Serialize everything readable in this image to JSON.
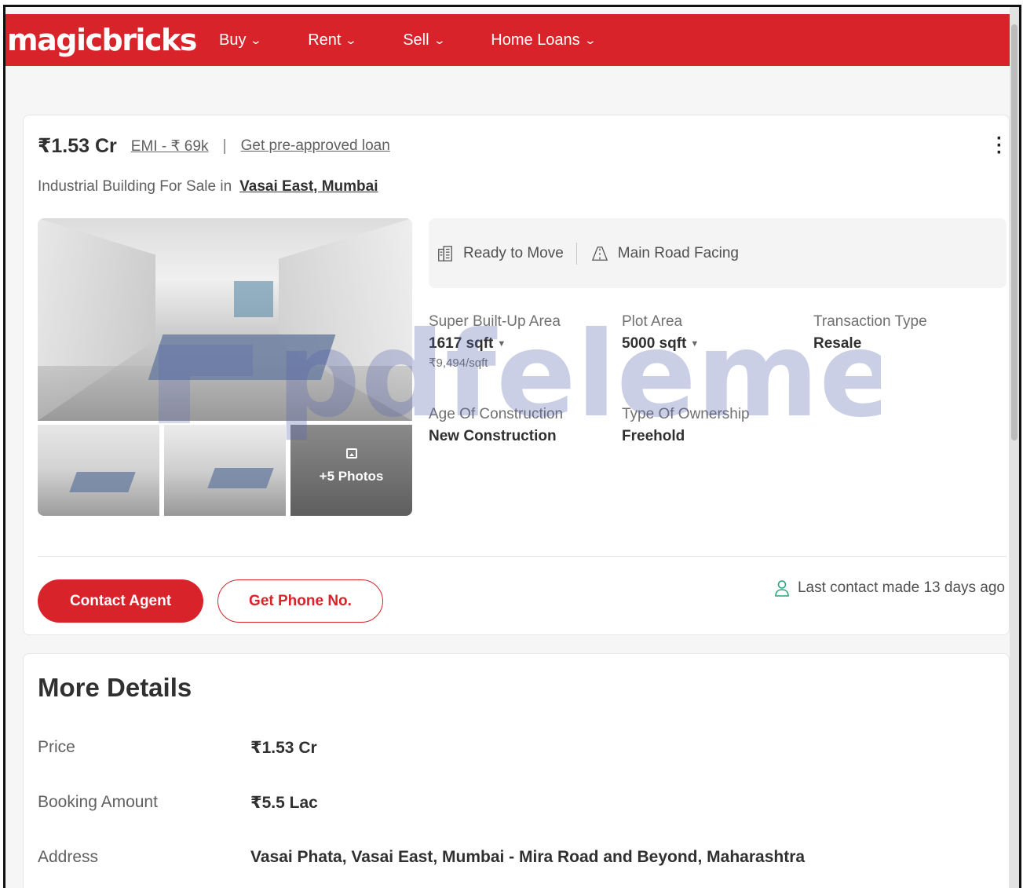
{
  "header": {
    "logo": "magicbricks",
    "nav": [
      {
        "label": "Buy"
      },
      {
        "label": "Rent"
      },
      {
        "label": "Sell"
      },
      {
        "label": "Home Loans"
      }
    ]
  },
  "listing": {
    "price": "₹1.53 Cr",
    "emi": "EMI - ₹ 69k",
    "separator": "|",
    "loan_link": "Get pre-approved loan",
    "title_prefix": "Industrial Building For Sale in",
    "location": "Vasai East, Mumbai",
    "more_photos": "+5 Photos",
    "highlights": [
      {
        "label": "Ready to Move",
        "icon": "building-icon"
      },
      {
        "label": "Main Road Facing",
        "icon": "road-icon"
      }
    ],
    "summary": {
      "super_area_label": "Super Built-Up Area",
      "super_area_value": "1617 sqft",
      "super_area_rate": "₹9,494/sqft",
      "plot_area_label": "Plot Area",
      "plot_area_value": "5000 sqft",
      "transaction_label": "Transaction Type",
      "transaction_value": "Resale",
      "age_label": "Age Of Construction",
      "age_value": "New Construction",
      "ownership_label": "Type Of Ownership",
      "ownership_value": "Freehold"
    },
    "contact_button": "Contact Agent",
    "phone_button": "Get Phone No.",
    "last_contact": "Last contact made 13 days ago"
  },
  "more_details": {
    "title": "More Details",
    "rows": [
      {
        "label": "Price",
        "value": "₹1.53 Cr"
      },
      {
        "label": "Booking Amount",
        "value": "₹5.5 Lac"
      },
      {
        "label": "Address",
        "value": "Vasai Phata, Vasai East, Mumbai - Mira Road and Beyond, Maharashtra"
      }
    ]
  },
  "watermark": "pdfelement",
  "colors": {
    "brand_red": "#d8232a",
    "watermark_blue": "#5462b0",
    "contact_green": "#2aa37a"
  }
}
